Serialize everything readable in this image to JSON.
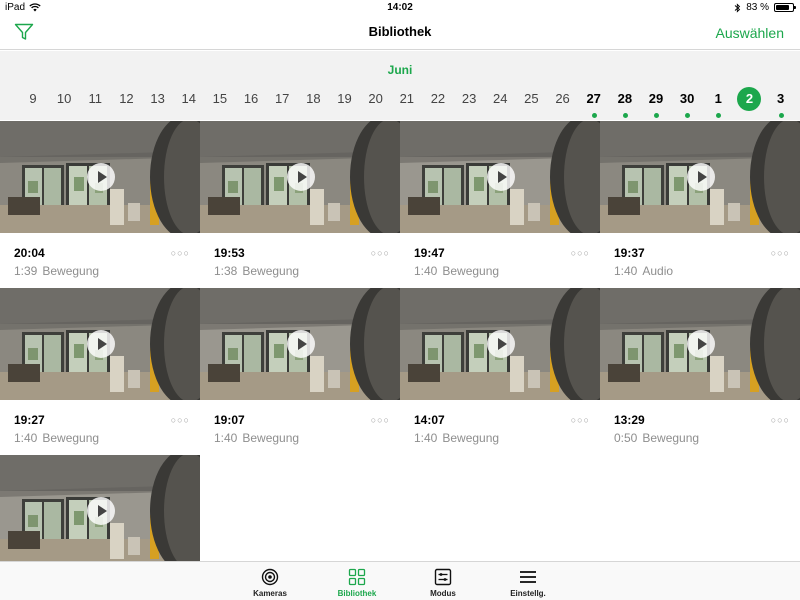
{
  "status_bar": {
    "device": "iPad",
    "time": "14:02",
    "battery": "83 %",
    "battery_level": 0.83
  },
  "nav": {
    "title": "Bibliothek",
    "select_label": "Auswählen"
  },
  "calendar": {
    "month": "Juni",
    "days": [
      {
        "label": "9",
        "has_events": false,
        "selected": false
      },
      {
        "label": "10",
        "has_events": false,
        "selected": false
      },
      {
        "label": "11",
        "has_events": false,
        "selected": false
      },
      {
        "label": "12",
        "has_events": false,
        "selected": false
      },
      {
        "label": "13",
        "has_events": false,
        "selected": false
      },
      {
        "label": "14",
        "has_events": false,
        "selected": false
      },
      {
        "label": "15",
        "has_events": false,
        "selected": false
      },
      {
        "label": "16",
        "has_events": false,
        "selected": false
      },
      {
        "label": "17",
        "has_events": false,
        "selected": false
      },
      {
        "label": "18",
        "has_events": false,
        "selected": false
      },
      {
        "label": "19",
        "has_events": false,
        "selected": false
      },
      {
        "label": "20",
        "has_events": false,
        "selected": false
      },
      {
        "label": "21",
        "has_events": false,
        "selected": false
      },
      {
        "label": "22",
        "has_events": false,
        "selected": false
      },
      {
        "label": "23",
        "has_events": false,
        "selected": false
      },
      {
        "label": "24",
        "has_events": false,
        "selected": false
      },
      {
        "label": "25",
        "has_events": false,
        "selected": false
      },
      {
        "label": "26",
        "has_events": false,
        "selected": false
      },
      {
        "label": "27",
        "has_events": true,
        "selected": false
      },
      {
        "label": "28",
        "has_events": true,
        "selected": false
      },
      {
        "label": "29",
        "has_events": true,
        "selected": false
      },
      {
        "label": "30",
        "has_events": true,
        "selected": false
      },
      {
        "label": "1",
        "has_events": true,
        "selected": false
      },
      {
        "label": "2",
        "has_events": false,
        "selected": true
      },
      {
        "label": "3",
        "has_events": true,
        "selected": false
      }
    ]
  },
  "recordings": [
    {
      "time": "20:04",
      "duration": "1:39",
      "type": "Bewegung",
      "thumbnail": true
    },
    {
      "time": "19:53",
      "duration": "1:38",
      "type": "Bewegung",
      "thumbnail": true
    },
    {
      "time": "19:47",
      "duration": "1:40",
      "type": "Bewegung",
      "thumbnail": true
    },
    {
      "time": "19:37",
      "duration": "1:40",
      "type": "Audio",
      "thumbnail": true
    },
    {
      "time": "19:27",
      "duration": "1:40",
      "type": "Bewegung",
      "thumbnail": true
    },
    {
      "time": "19:07",
      "duration": "1:40",
      "type": "Bewegung",
      "thumbnail": true
    },
    {
      "time": "14:07",
      "duration": "1:40",
      "type": "Bewegung",
      "thumbnail": true
    },
    {
      "time": "13:29",
      "duration": "0:50",
      "type": "Bewegung",
      "thumbnail": true
    },
    {
      "time": "",
      "duration": "",
      "type": "",
      "thumbnail": true
    }
  ],
  "tabs": [
    {
      "label": "Kameras",
      "icon": "camera-lens-icon",
      "active": false
    },
    {
      "label": "Bibliothek",
      "icon": "grid-icon",
      "active": true
    },
    {
      "label": "Modus",
      "icon": "sliders-icon",
      "active": false
    },
    {
      "label": "Einstellg.",
      "icon": "menu-icon",
      "active": false
    }
  ],
  "colors": {
    "accent": "#1ca74c"
  }
}
